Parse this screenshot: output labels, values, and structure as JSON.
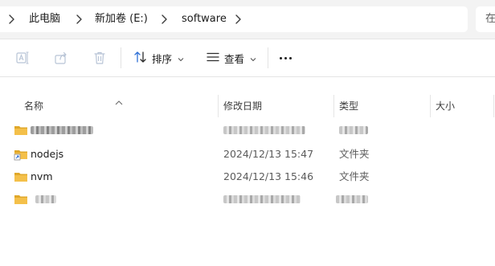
{
  "address": {
    "crumbs": [
      "此电脑",
      "新加卷 (E:)",
      "software"
    ],
    "search_hint": "在"
  },
  "toolbar": {
    "sort_label": "排序",
    "view_label": "查看"
  },
  "columns": {
    "name": "名称",
    "date": "修改日期",
    "type": "类型",
    "size": "大小"
  },
  "rows": [
    {
      "name": "",
      "date": "",
      "type": "",
      "redacted": true
    },
    {
      "name": "nodejs",
      "date": "2024/12/13 15:47",
      "type": "文件夹",
      "shortcut": true
    },
    {
      "name": "nvm",
      "date": "2024/12/13 15:46",
      "type": "文件夹"
    },
    {
      "name": "",
      "date": "",
      "type": "",
      "redacted": true
    }
  ],
  "colors": {
    "folder_yellow": "#f4c04a",
    "folder_dark": "#e0a82a",
    "accent_blue": "#2d6fd6"
  }
}
